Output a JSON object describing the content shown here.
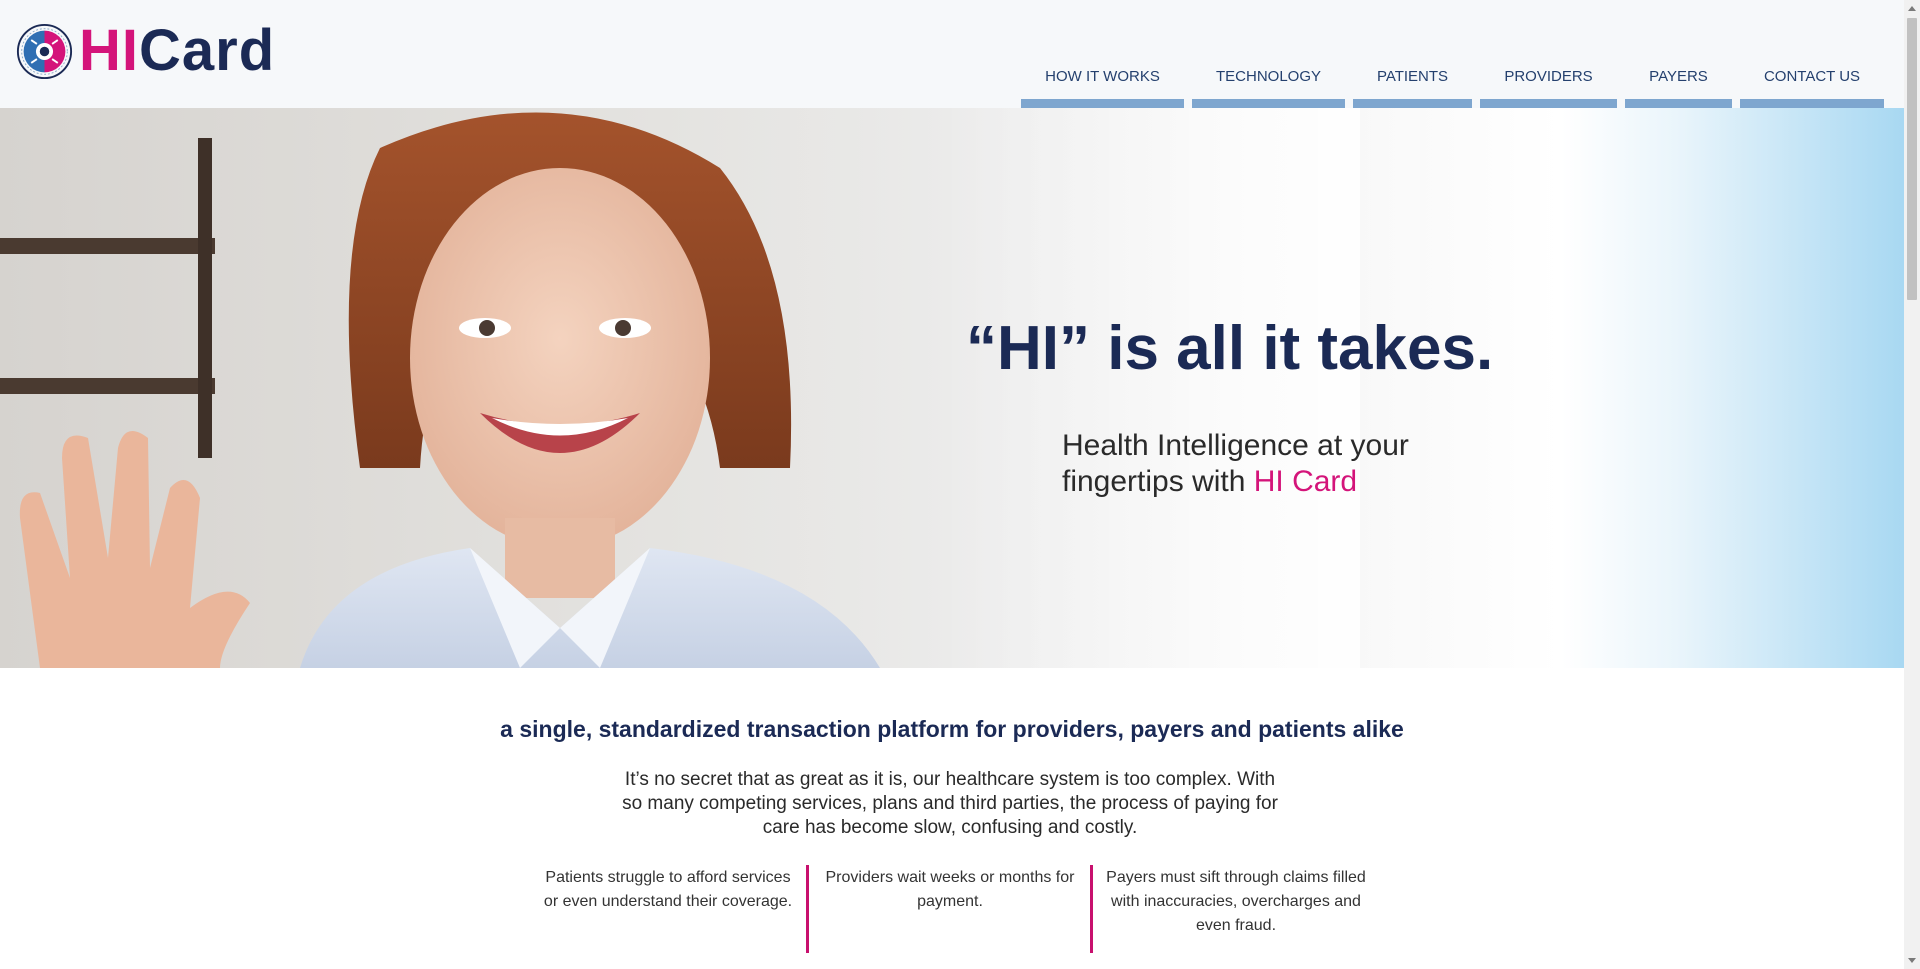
{
  "logo": {
    "hi": "HI",
    "card": "Card"
  },
  "nav": [
    {
      "label": "HOW IT WORKS"
    },
    {
      "label": "TECHNOLOGY"
    },
    {
      "label": "PATIENTS"
    },
    {
      "label": "PROVIDERS"
    },
    {
      "label": "PAYERS"
    },
    {
      "label": "CONTACT US"
    }
  ],
  "hero": {
    "title_quote": "“HI”",
    "title_rest": " is all it takes.",
    "sub_line1": "Health Intelligence at your",
    "sub_line2": "fingertips with ",
    "sub_brand": "HI Card"
  },
  "tagline": "a single, standardized transaction platform for providers, payers and patients alike",
  "intro": "It’s no secret that as great as it is, our healthcare system is too complex. With so many competing services, plans and third parties, the process of paying for care has become slow, confusing and costly.",
  "columns": [
    {
      "text": "Patients struggle to afford services or even understand their coverage."
    },
    {
      "text": "Providers wait weeks or months for payment."
    },
    {
      "text": "Payers must sift through claims filled with inaccuracies, overcharges and even fraud."
    }
  ],
  "colors": {
    "brand_pink": "#d4147a",
    "brand_navy": "#1b2a55",
    "nav_bar": "#7ea6cf"
  }
}
